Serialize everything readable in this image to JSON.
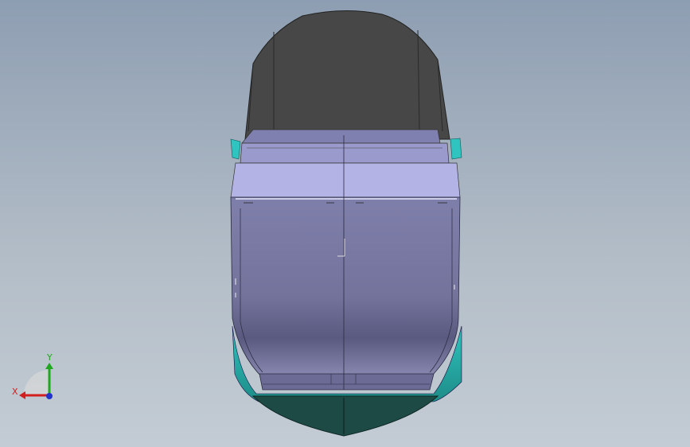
{
  "viewport": {
    "background_top": "#8e9eb2",
    "background_bottom": "#c3ccd4"
  },
  "model": {
    "body_color": "#7a7aa6",
    "top_face_color": "#b3b3e6",
    "back_color": "#474747",
    "trim_color": "#2ab3b0",
    "dark_trim_color": "#1d4a45"
  },
  "triad": {
    "x_label": "X",
    "y_label": "Y",
    "x_color": "#d21e1e",
    "y_color": "#1fa81f",
    "z_color": "#2233cc"
  }
}
